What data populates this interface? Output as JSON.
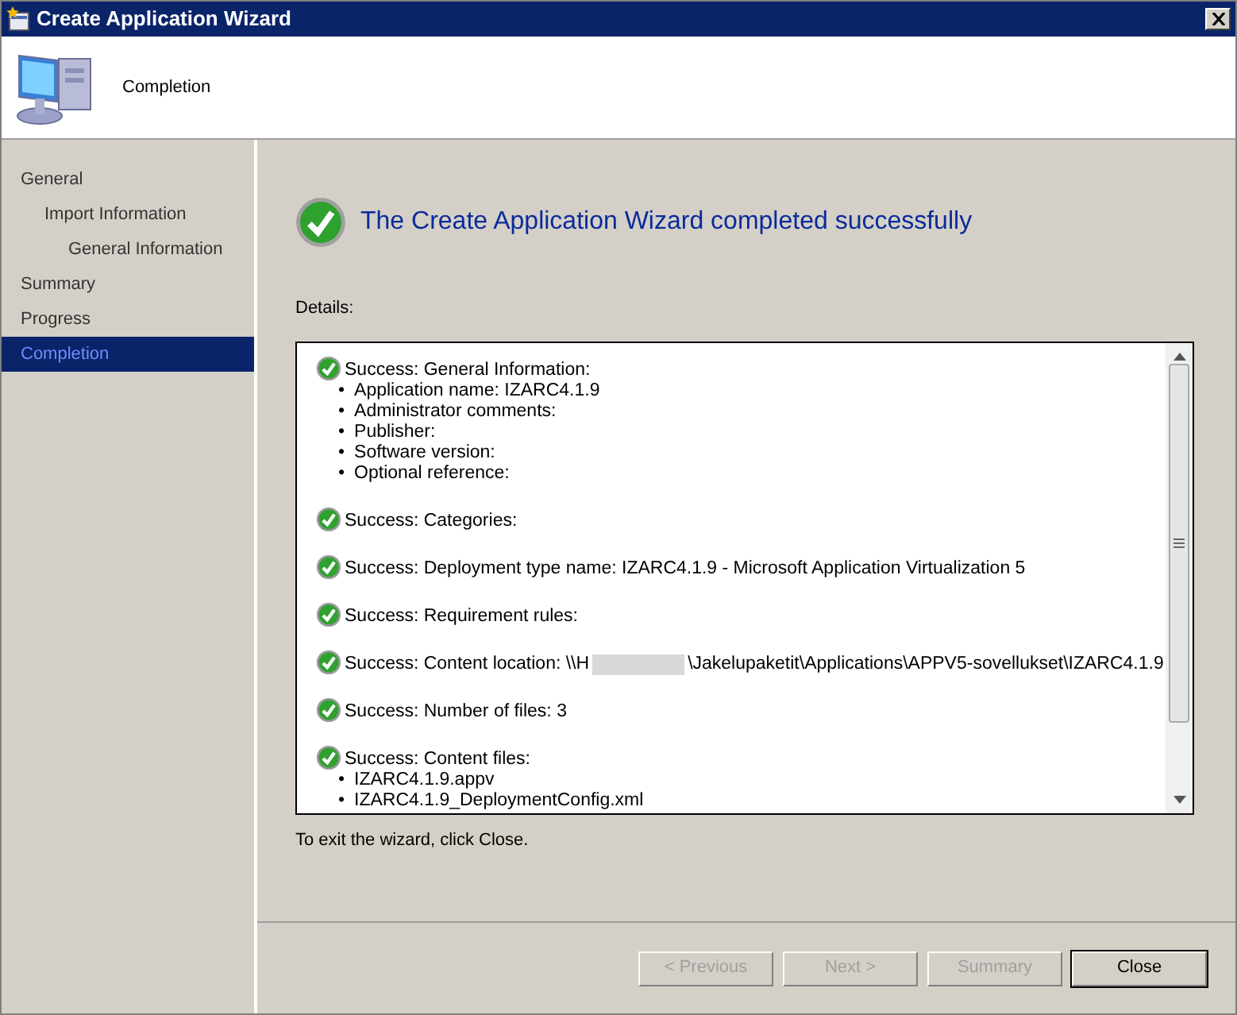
{
  "window": {
    "title": "Create Application Wizard"
  },
  "header": {
    "title": "Completion"
  },
  "steps": [
    {
      "label": "General",
      "selected": false,
      "children": [
        {
          "label": "Import Information",
          "selected": false,
          "children": [
            {
              "label": "General Information",
              "selected": false
            }
          ]
        }
      ]
    },
    {
      "label": "Summary",
      "selected": false
    },
    {
      "label": "Progress",
      "selected": false
    },
    {
      "label": "Completion",
      "selected": true
    }
  ],
  "result": {
    "heading": "The Create Application Wizard completed successfully"
  },
  "details_label": "Details:",
  "details": [
    {
      "text": "Success: General Information:",
      "items": [
        {
          "bullet": "•",
          "text": "Application name: IZARC4.1.9"
        },
        {
          "bullet": "•",
          "text": "Administrator comments:"
        },
        {
          "bullet": "•",
          "text": "Publisher:"
        },
        {
          "bullet": "•",
          "text": "Software version:"
        },
        {
          "bullet": "•",
          "text": "Optional reference:"
        }
      ]
    },
    {
      "text": "Success: Categories:"
    },
    {
      "text": "Success: Deployment type name: IZARC4.1.9 - Microsoft Application Virtualization 5"
    },
    {
      "text": "Success: Requirement rules:"
    },
    {
      "text": "Success: Content location: \\\\H",
      "redacted": true,
      "text_after": "\\Jakelupaketit\\Applications\\APPV5-sovellukset\\IZARC4.1.9"
    },
    {
      "text": "Success: Number of files: 3"
    },
    {
      "text": "Success: Content files:",
      "items": [
        {
          "bullet": "•",
          "text": "IZARC4.1.9.appv"
        },
        {
          "bullet": "•",
          "text": "IZARC4.1.9_DeploymentConfig.xml"
        }
      ]
    }
  ],
  "exit_hint": "To exit the wizard, click Close.",
  "buttons": [
    {
      "label": "< Previous",
      "disabled": true,
      "default": false
    },
    {
      "label": "Next >",
      "disabled": true,
      "default": false
    },
    {
      "label": "Summary",
      "disabled": true,
      "default": false
    },
    {
      "label": "Close",
      "disabled": false,
      "default": true
    }
  ]
}
